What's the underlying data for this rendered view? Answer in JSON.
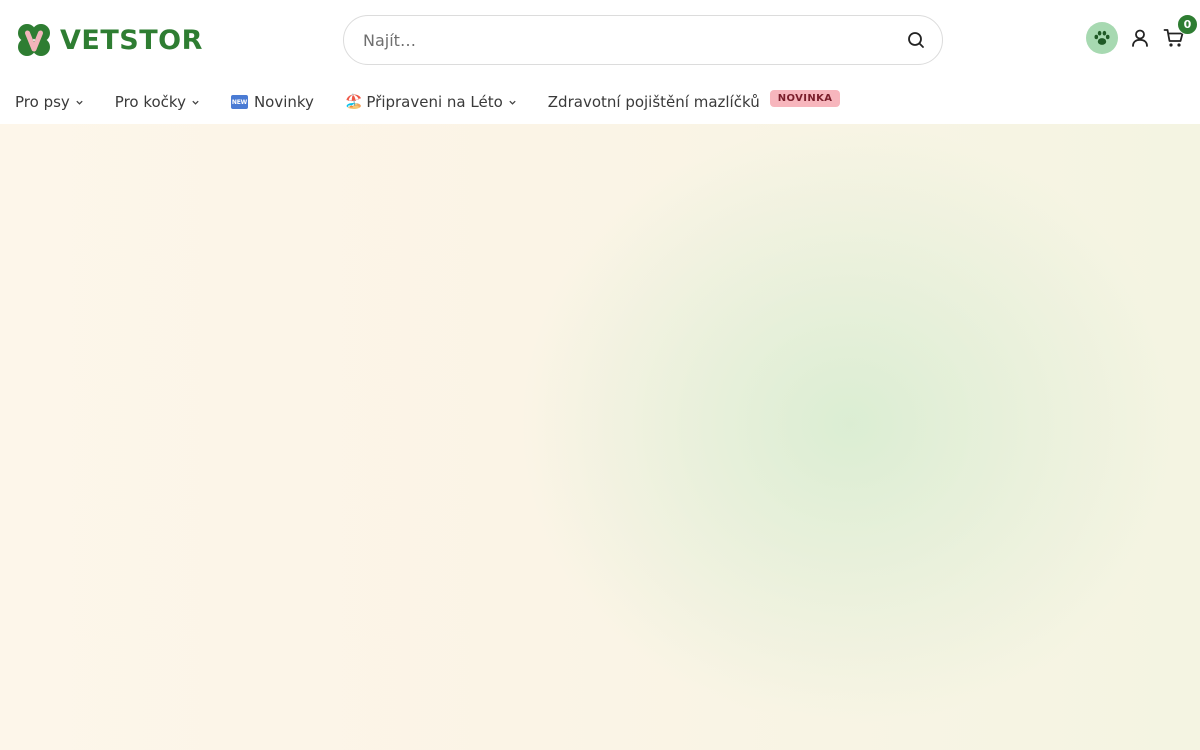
{
  "brand": {
    "name": "VETSTOR",
    "logo_letter": "V",
    "accent": "#2e7d32"
  },
  "search": {
    "placeholder": "Najít…"
  },
  "header_actions": {
    "paw_icon": "paw-icon",
    "account_icon": "user-icon",
    "cart_icon": "cart-icon",
    "cart_count": "0"
  },
  "nav": {
    "items": [
      {
        "label": "Pro psy",
        "has_dropdown": true
      },
      {
        "label": "Pro kočky",
        "has_dropdown": true
      },
      {
        "label": "Novinky",
        "emoji": "🆕"
      },
      {
        "label": "Připraveni na Léto",
        "emoji": "🏖️",
        "has_dropdown": true
      },
      {
        "label": "Zdravotní pojištění mazlíčků",
        "badge": "NOVINKA"
      }
    ]
  },
  "colors": {
    "badge_bg": "#f7b6bd",
    "hero_bg": "#fbf4e6",
    "hero_glow": "#d6ecd0"
  }
}
